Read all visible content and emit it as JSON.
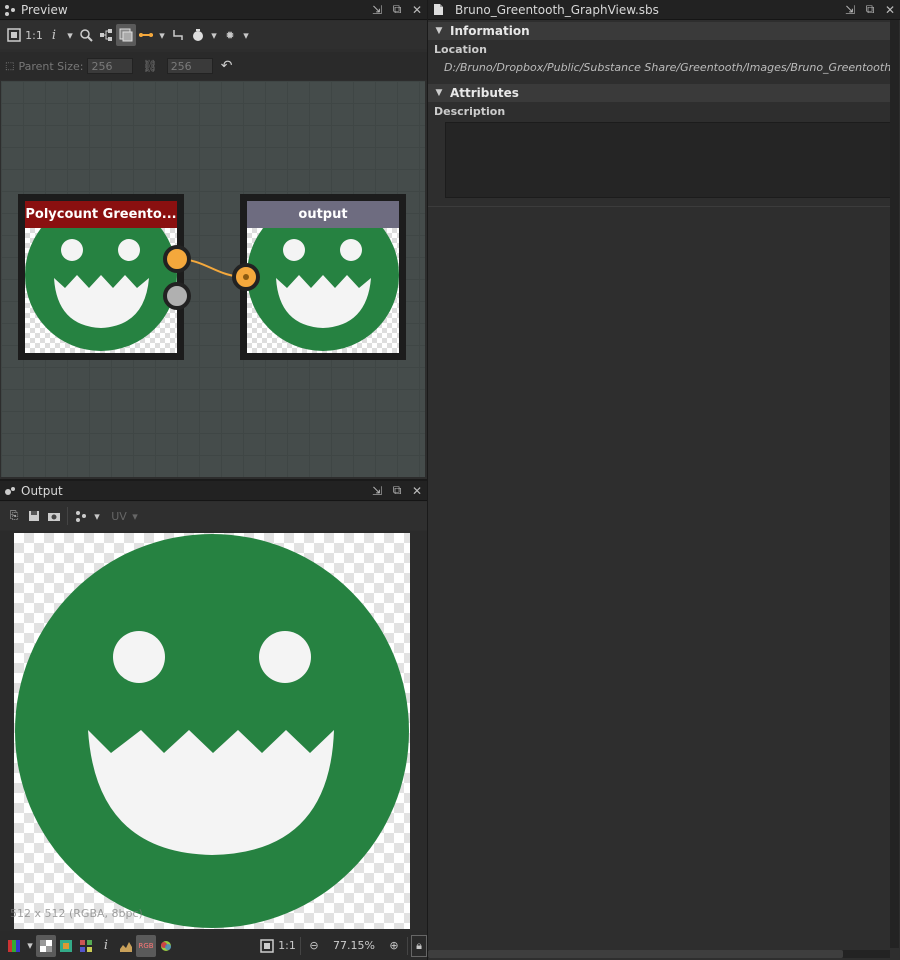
{
  "preview": {
    "title": "Preview",
    "toolbar": {
      "zoom_1to1": "1:1",
      "info": "i"
    },
    "parent_size_label": "Parent Size:",
    "parent_width": "256",
    "parent_height": "256"
  },
  "graph": {
    "node1_title": "Polycount Greento...",
    "node1_color": "#8a1010",
    "node2_title": "output",
    "node2_color": "#6e6c80",
    "link_color": "#f4a83c",
    "content_color": "#268241"
  },
  "output": {
    "title": "Output",
    "toolbar": {
      "uv": "UV"
    },
    "image_info": "512 x 512 (RGBA, 8bpc)",
    "bottom": {
      "info": "i",
      "zoom_1to1": "1:1",
      "zoom": "77.15%"
    }
  },
  "properties": {
    "title": "Bruno_Greentooth_GraphView.sbs",
    "information_header": "Information",
    "location_label": "Location",
    "location_value": "D:/Bruno/Dropbox/Public/Substance Share/Greentooth/Images/Bruno_Greentooth_GraphView.png",
    "attributes_header": "Attributes",
    "description_label": "Description",
    "description_value": ""
  }
}
